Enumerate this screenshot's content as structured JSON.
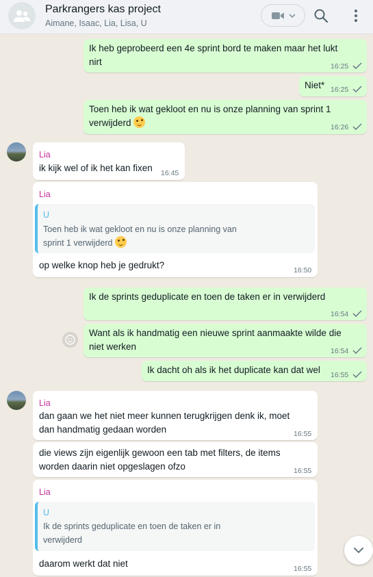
{
  "header": {
    "title": "Parkrangers kas project",
    "members": "Aimane, Isaac, Lia, Lisa, U"
  },
  "messages": {
    "m1": {
      "line1": "Ik heb geprobeerd een 4e sprint bord te maken maar het lukt",
      "line2": "nirt",
      "time": "16:25"
    },
    "m2": {
      "text": "Niet*",
      "time": "16:25"
    },
    "m3": {
      "line1": "Toen heb ik wat gekloot en nu is onze planning van sprint 1",
      "line2": "verwijderd",
      "time": "16:26"
    },
    "m4": {
      "sender": "Lia",
      "text": "ik kijk wel of ik het kan fixen",
      "time": "16:45"
    },
    "m5": {
      "sender": "Lia",
      "quote_author": "U",
      "quote_line1": "Toen heb ik wat gekloot en nu is onze planning van",
      "quote_line2": "sprint 1 verwijderd",
      "text": "op welke knop heb je gedrukt?",
      "time": "16:50"
    },
    "m6": {
      "text": "Ik de sprints geduplicate en toen de taken er in verwijderd",
      "time": "16:54"
    },
    "m7": {
      "line1": "Want als ik handmatig een nieuwe sprint aanmaakte wilde die",
      "line2": "niet werken",
      "time": "16:54"
    },
    "m8": {
      "text": "Ik dacht oh als ik het duplicate kan dat wel",
      "time": "16:55"
    },
    "m9": {
      "sender": "Lia",
      "line1": "dan gaan we het niet meer kunnen terugkrijgen denk ik, moet",
      "line2": "dan handmatig gedaan worden",
      "time": "16:55"
    },
    "m10": {
      "line1": "die views zijn eigenlijk gewoon een tab met filters, de items",
      "line2": "worden daarin niet opgeslagen ofzo",
      "time": "16:55"
    },
    "m11": {
      "sender": "Lia",
      "quote_author": "U",
      "quote_line1": "Ik de sprints geduplicate en toen de taken er in",
      "quote_line2": "verwijderd",
      "text": "daarom werkt dat niet",
      "time": "16:55"
    }
  },
  "colors": {
    "outgoing": "#d9fdd3",
    "incoming": "#ffffff",
    "sender": "#c4339c",
    "read_tick": "#667781",
    "quote_bar": "#53bdeb"
  },
  "icons": [
    "group-avatar-icon",
    "video-call-icon",
    "chevron-down-icon",
    "search-icon",
    "menu-icon",
    "check-icon",
    "emoji-icon",
    "scroll-down-icon"
  ]
}
